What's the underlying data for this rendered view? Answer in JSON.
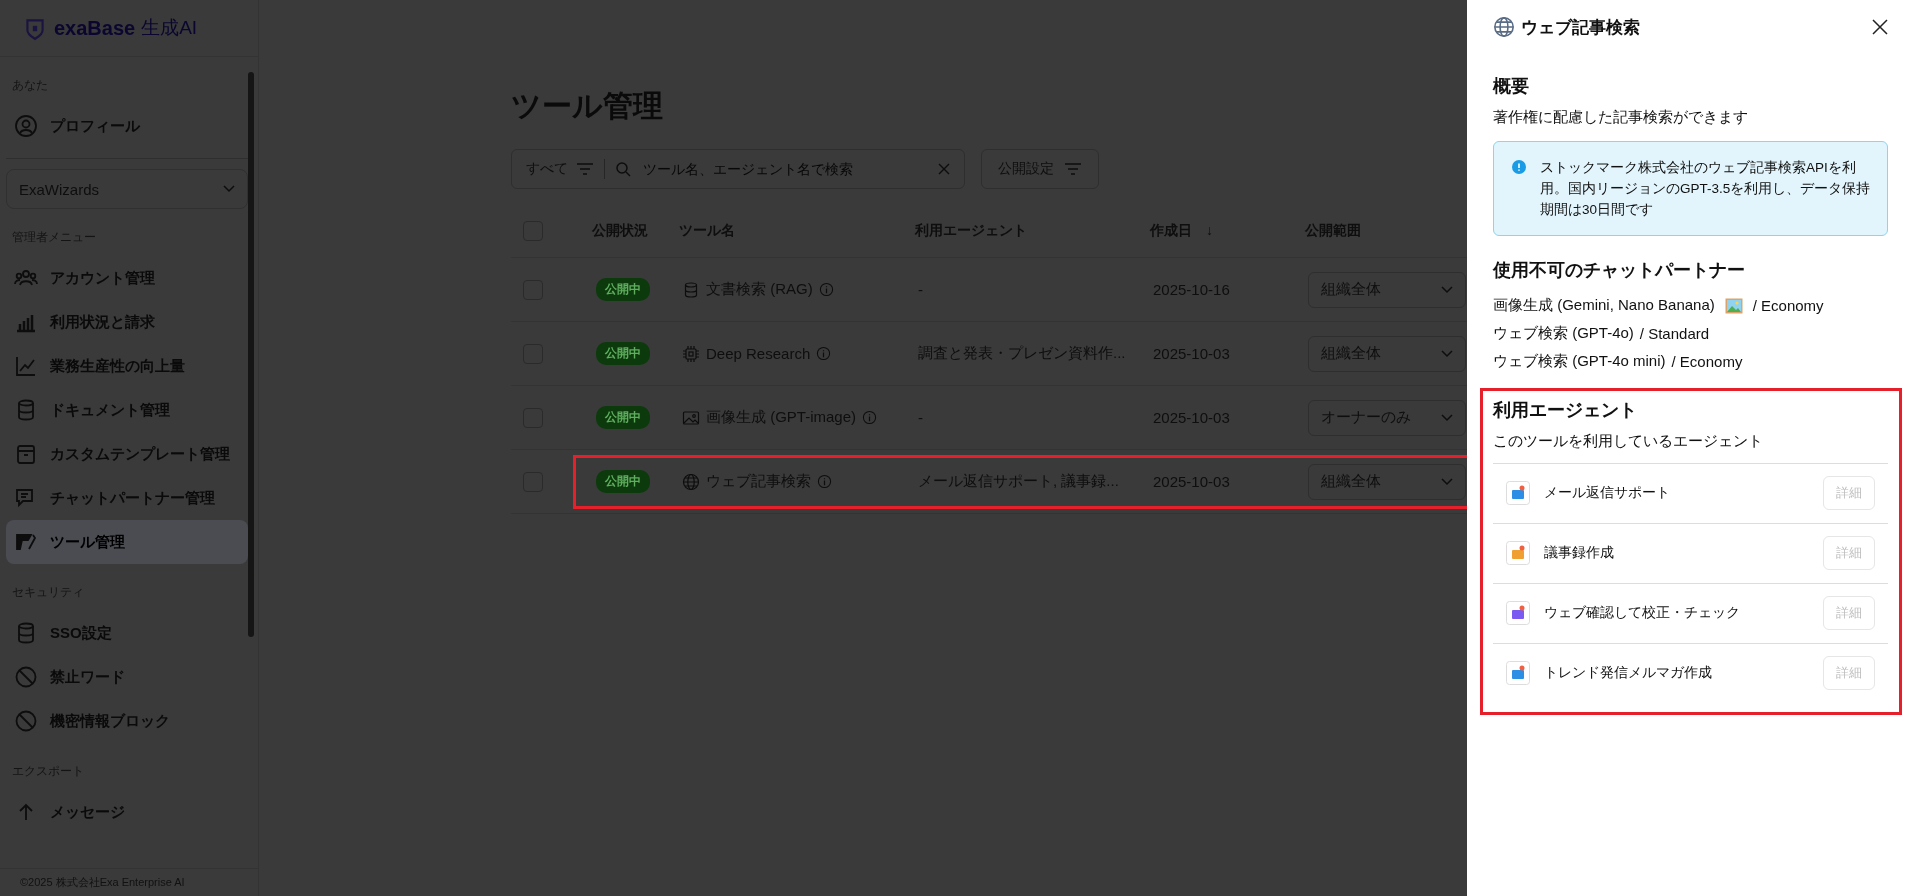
{
  "app": {
    "logo_text": "exaBase",
    "logo_suffix": "生成AI"
  },
  "sidebar": {
    "top_section": {
      "label": "あなた",
      "items": [
        {
          "label": "プロフィール",
          "selected": false
        }
      ]
    },
    "workspace": "ExaWizards",
    "sections": [
      {
        "label": "管理者メニュー",
        "items": [
          {
            "label": "アカウント管理",
            "selected": false
          },
          {
            "label": "利用状況と請求",
            "selected": false
          },
          {
            "label": "業務生産性の向上量",
            "selected": false
          },
          {
            "label": "ドキュメント管理",
            "selected": false
          },
          {
            "label": "カスタムテンプレート管理",
            "selected": false
          },
          {
            "label": "チャットパートナー管理",
            "selected": false
          },
          {
            "label": "ツール管理",
            "selected": true
          }
        ]
      },
      {
        "label": "セキュリティ",
        "items": [
          {
            "label": "SSO設定",
            "selected": false
          },
          {
            "label": "禁止ワード",
            "selected": false
          },
          {
            "label": "機密情報ブロック",
            "selected": false
          }
        ]
      },
      {
        "label": "エクスポート",
        "items": [
          {
            "label": "メッセージ",
            "selected": false
          }
        ]
      }
    ],
    "footer": "©2025 株式会社Exa Enterprise AI"
  },
  "main": {
    "title": "ツール管理",
    "filter": "すべて",
    "search": {
      "placeholder": "ツール名、エージェント名で検索"
    },
    "publish_button": "公開設定",
    "table": {
      "select_all_checked": false,
      "columns": [
        "公開状況",
        "ツール名",
        "利用エージェント",
        "作成日",
        "公開範囲"
      ],
      "sort_indicator": "↓",
      "rows": [
        {
          "checked": false,
          "status": "公開中",
          "name": "文書検索 (RAG)",
          "agents": "-",
          "date": "2025-10-16",
          "scope": "組織全体",
          "highlighted": false
        },
        {
          "checked": false,
          "status": "公開中",
          "name": "Deep Research",
          "agents": "調査と発表・プレゼン資料作...",
          "date": "2025-10-03",
          "scope": "組織全体",
          "highlighted": false
        },
        {
          "checked": false,
          "status": "公開中",
          "name": "画像生成 (GPT-image)",
          "agents": "-",
          "date": "2025-10-03",
          "scope": "オーナーのみ",
          "highlighted": false
        },
        {
          "checked": false,
          "status": "公開中",
          "name": "ウェブ記事検索",
          "agents": "メール返信サポート, 議事録...",
          "date": "2025-10-03",
          "scope": "組織全体",
          "highlighted": true
        }
      ]
    }
  },
  "panel": {
    "title": "ウェブ記事検索",
    "overview": {
      "heading": "概要",
      "description": "著作権に配慮した記事検索ができます",
      "notice": "ストックマーク株式会社のウェブ記事検索APIを利用。国内リージョンのGPT-3.5を利用し、データ保持期間は30日間です"
    },
    "unavailable": {
      "heading": "使用不可のチャットパートナー",
      "items": [
        {
          "kind": "with-image",
          "name": "画像生成 (Gemini, Nano Banana)",
          "tier": "/ Economy"
        },
        {
          "kind": "plain",
          "name": "ウェブ検索 (GPT-4o)",
          "tier": "/ Standard"
        },
        {
          "kind": "plain",
          "name": "ウェブ検索 (GPT-4o mini)",
          "tier": "/ Economy"
        }
      ]
    },
    "agents": {
      "heading": "利用エージェント",
      "subtitle": "このツールを利用しているエージェント",
      "highlighted": true,
      "items": [
        {
          "name": "メール返信サポート",
          "button": "詳細",
          "disabled": true
        },
        {
          "name": "議事録作成",
          "button": "詳細",
          "disabled": true
        },
        {
          "name": "ウェブ確認して校正・チェック",
          "button": "詳細",
          "disabled": true
        },
        {
          "name": "トレンド発信メルマガ作成",
          "button": "詳細",
          "disabled": true
        }
      ]
    }
  }
}
